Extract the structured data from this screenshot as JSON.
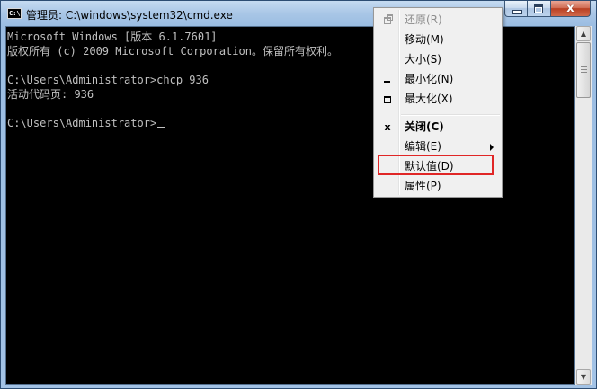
{
  "window": {
    "title": "管理员: C:\\windows\\system32\\cmd.exe",
    "app_icon_text": "C:\\",
    "controls": {
      "minimize_icon": "minimize-icon",
      "maximize_icon": "maximize-icon",
      "close_glyph": "x"
    }
  },
  "console": {
    "lines": [
      "Microsoft Windows [版本 6.1.7601]",
      "版权所有 (c) 2009 Microsoft Corporation。保留所有权利。",
      "",
      "C:\\Users\\Administrator>chcp 936",
      "活动代码页: 936",
      "",
      "C:\\Users\\Administrator>"
    ]
  },
  "scrollbar": {
    "up_glyph": "▲",
    "down_glyph": "▼"
  },
  "system_menu": {
    "items": [
      {
        "label": "还原(R)",
        "icon": "restore-icon",
        "enabled": false
      },
      {
        "label": "移动(M)"
      },
      {
        "label": "大小(S)"
      },
      {
        "label": "最小化(N)",
        "icon": "minimize-icon"
      },
      {
        "label": "最大化(X)",
        "icon": "maximize-icon"
      },
      {
        "label": "关闭(C)",
        "icon": "close-icon",
        "icon_glyph": "x",
        "bold": true
      },
      {
        "label": "编辑(E)",
        "submenu": true
      },
      {
        "label": "默认值(D)",
        "highlighted": true,
        "highlight_color": "#e02626"
      },
      {
        "label": "属性(P)"
      }
    ]
  },
  "colors": {
    "console_bg": "#000000",
    "console_text": "#c0c0c0",
    "highlight_border": "#e02626"
  }
}
